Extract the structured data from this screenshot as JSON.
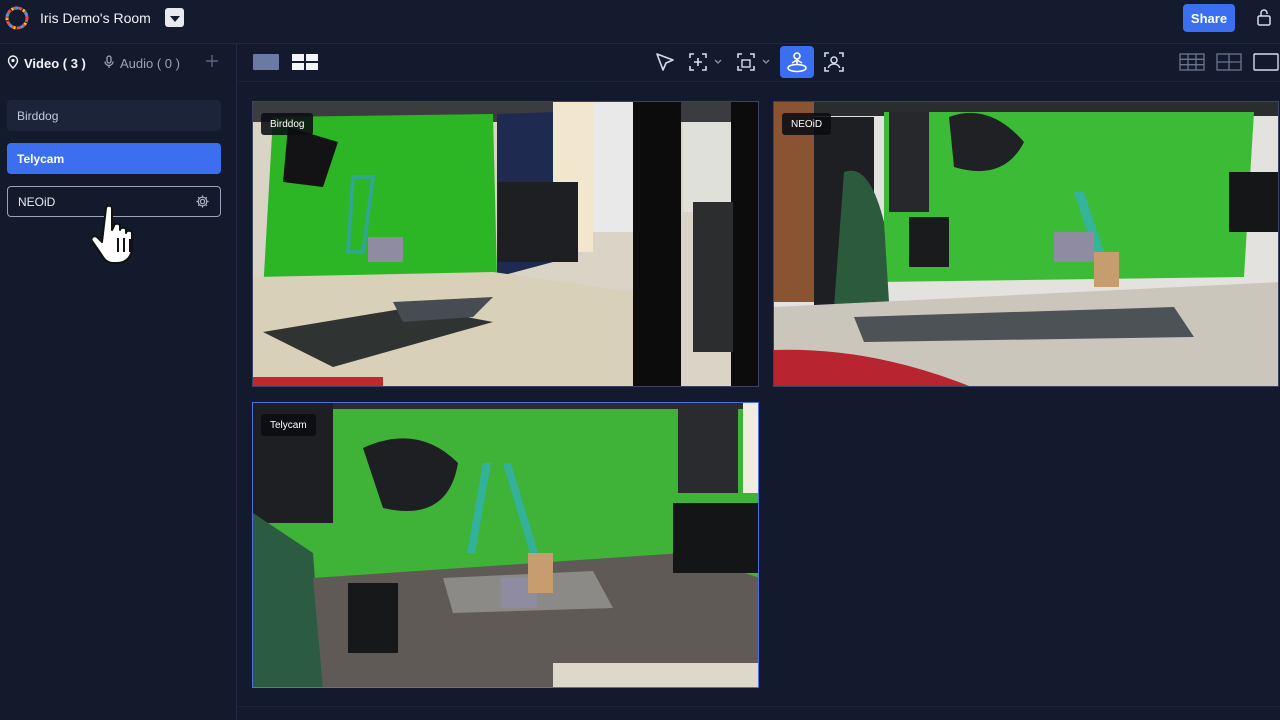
{
  "room": {
    "title": "Iris Demo's Room"
  },
  "header": {
    "share_label": "Share"
  },
  "sidebar": {
    "tabs": [
      {
        "label": "Video ( 3 )",
        "icon": "location-pin-icon"
      },
      {
        "label": "Audio ( 0 )",
        "icon": "microphone-icon"
      }
    ],
    "sources": [
      {
        "label": "Birddog",
        "state": "normal"
      },
      {
        "label": "Telycam",
        "state": "selected"
      },
      {
        "label": "NEOiD",
        "state": "hover"
      }
    ]
  },
  "toolbar": {
    "left_icons": [
      "single-layout-icon",
      "grid-layout-icon"
    ],
    "center_icons": [
      "select-pointer-icon",
      "crop-add-icon",
      "region-icon",
      "tracking-person-icon",
      "face-detect-icon"
    ],
    "active_tool": "tracking-person-icon",
    "right_icons": [
      "grid-3x3-icon",
      "grid-2x2-icon",
      "fullscreen-icon"
    ]
  },
  "tiles": [
    {
      "label": "Birddog"
    },
    {
      "label": "NEOiD"
    },
    {
      "label": "Telycam"
    }
  ],
  "colors": {
    "accent": "#3b6ff0",
    "background": "#141a2e",
    "green_screen": "#2fb82a"
  }
}
